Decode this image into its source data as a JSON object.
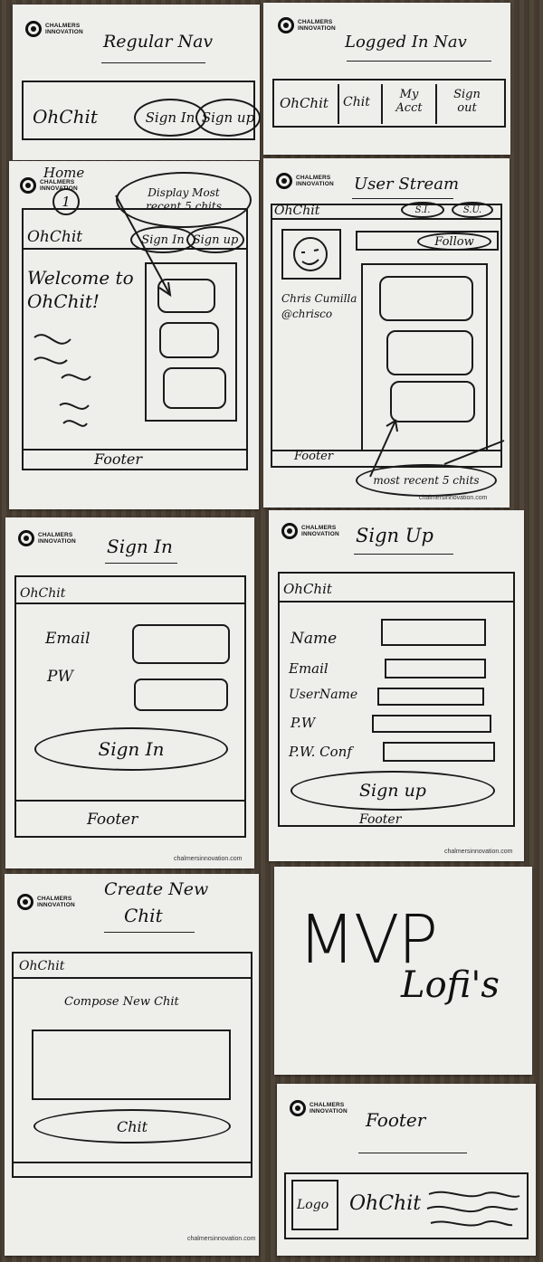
{
  "brand": {
    "line1": "CHALMERS",
    "line2": "INNOVATION",
    "url": "chalmersinnovation.com"
  },
  "cards": {
    "regular_nav": {
      "title": "Regular Nav",
      "app": "OhChit",
      "sign_in": "Sign In",
      "sign_up": "Sign up"
    },
    "logged_in_nav": {
      "title": "Logged In Nav",
      "items": [
        "OhChit",
        "Chit",
        "My Acct",
        "Sign out"
      ]
    },
    "home": {
      "title": "Home",
      "number": "1",
      "note": "Display Most recent 5 chits",
      "app": "OhChit",
      "sign_in": "Sign In",
      "sign_up": "Sign up",
      "welcome": "Welcome to OhChit!",
      "footer": "Footer"
    },
    "user_stream": {
      "title": "User Stream",
      "app": "OhChit",
      "si": "S.I.",
      "su": "S.U.",
      "follow": "Follow",
      "user_name": "Chris Cumilla",
      "handle": "@chrisco",
      "footer": "Footer",
      "note": "most recent 5 chits"
    },
    "sign_in": {
      "title": "Sign In",
      "app": "OhChit",
      "email": "Email",
      "pw": "PW",
      "button": "Sign In",
      "footer": "Footer"
    },
    "sign_up": {
      "title": "Sign Up",
      "app": "OhChit",
      "fields": [
        "Name",
        "Email",
        "UserName",
        "P.W",
        "P.W. Conf"
      ],
      "button": "Sign up",
      "footer": "Footer"
    },
    "create_chit": {
      "title_1": "Create New",
      "title_2": "Chit",
      "app": "OhChit",
      "compose": "Compose New Chit",
      "button": "Chit"
    },
    "mvp": {
      "line1": "MVP",
      "line2": "Lofi's"
    },
    "footer_card": {
      "title": "Footer",
      "logo": "Logo",
      "app": "OhChit"
    }
  }
}
